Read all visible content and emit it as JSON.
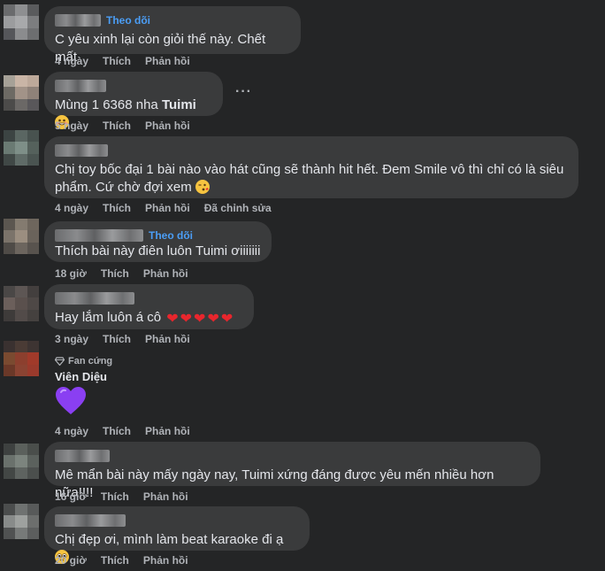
{
  "comments": [
    {
      "follow": "Theo dõi",
      "text": "C yêu xinh lại còn giỏi thế này. Chết mất",
      "time": "4 ngày",
      "like": "Thích",
      "reply": "Phản hồi"
    },
    {
      "text_prefix": "Mùng 1 6368 nha ",
      "text_bold": "Tuimi",
      "time": "5 ngày",
      "like": "Thích",
      "reply": "Phản hồi",
      "more": "···",
      "emoji": "grinning-face-icon"
    },
    {
      "text_line1": "Chị toy bốc đại 1 bài nào vào hát cũng sẽ thành hit hết. Đem Smile vô thì chỉ có là siêu",
      "text_line2": "phẩm. Cứ chờ đợi xem",
      "time": "4 ngày",
      "like": "Thích",
      "reply": "Phản hồi",
      "edited": "Đã chỉnh sửa",
      "emoji": "kissing-face-icon"
    },
    {
      "follow": "Theo dõi",
      "text": "Thích bài này điên luôn Tuimi ơiiiiiii",
      "time": "18 giờ",
      "like": "Thích",
      "reply": "Phản hồi"
    },
    {
      "text": "Hay lắm luôn á cô",
      "time": "3 ngày",
      "like": "Thích",
      "reply": "Phản hồi",
      "hearts": "❤❤❤❤❤"
    },
    {
      "badge": "Fan cứng",
      "name": "Viên Diệu",
      "sticker": "purple-heart-icon",
      "time": "4 ngày",
      "like": "Thích",
      "reply": "Phản hồi"
    },
    {
      "text": "Mê mẩn bài này mấy ngày nay, Tuimi xứng đáng được yêu mến nhiều hơn nữa!!!!",
      "time": "16 giờ",
      "like": "Thích",
      "reply": "Phản hồi"
    },
    {
      "text": "Chị đẹp ơi, mình làm beat karaoke đi ạ",
      "time": "20 giờ",
      "like": "Thích",
      "reply": "Phản hồi",
      "emoji": "pleading-face-icon"
    }
  ],
  "colors": {
    "background": "#242526",
    "bubble": "#3a3b3c",
    "follow": "#4b9ef6",
    "heart": "#e8262d",
    "sticker": "#8a3ff2"
  }
}
